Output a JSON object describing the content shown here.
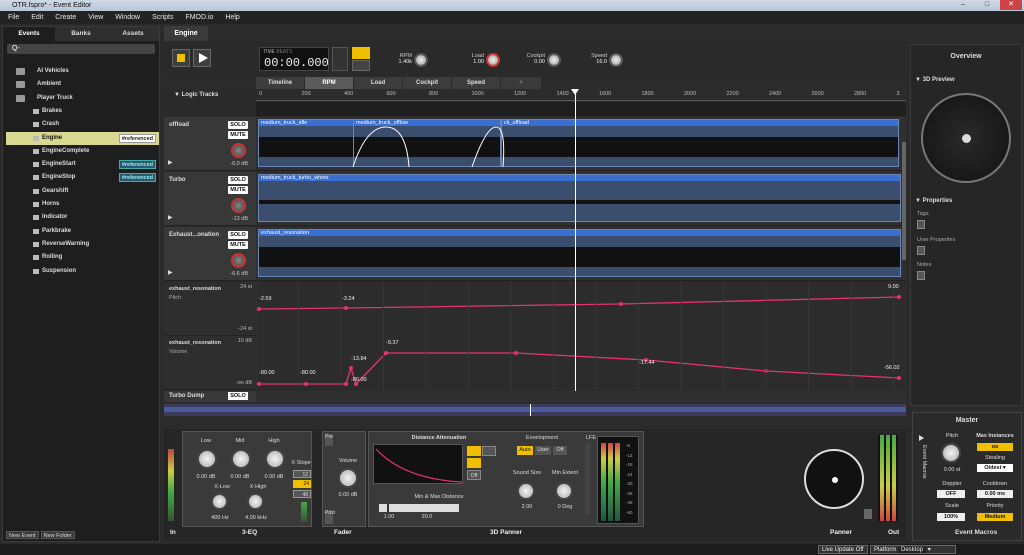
{
  "window": {
    "title": "OTR.fspro* - Event Editor"
  },
  "menu": [
    "File",
    "Edit",
    "Create",
    "View",
    "Window",
    "Scripts",
    "FMOD.io",
    "Help"
  ],
  "browser": {
    "tabs": [
      "Events",
      "Banks",
      "Assets"
    ],
    "search_placeholder": "Q-",
    "folders": [
      "AI Vehicles",
      "Ambient",
      "Player Truck"
    ],
    "events": [
      {
        "name": "Brakes",
        "badge": ""
      },
      {
        "name": "Crash",
        "badge": ""
      },
      {
        "name": "Engine",
        "badge": "#referenced"
      },
      {
        "name": "EngineComplete",
        "badge": ""
      },
      {
        "name": "EngineStart",
        "badge": "#referenced"
      },
      {
        "name": "EngineStop",
        "badge": "#referenced"
      },
      {
        "name": "Gearshift",
        "badge": ""
      },
      {
        "name": "Horns",
        "badge": ""
      },
      {
        "name": "Indicator",
        "badge": ""
      },
      {
        "name": "Parkbrake",
        "badge": ""
      },
      {
        "name": "ReverseWarning",
        "badge": ""
      },
      {
        "name": "Rolling",
        "badge": ""
      },
      {
        "name": "Suspension",
        "badge": ""
      }
    ],
    "footer": [
      "New Event",
      "New Folder"
    ]
  },
  "editor": {
    "tab": "Engine",
    "time_label_1": "TIME",
    "time_label_2": "BEATS",
    "time_value": "00:00.000",
    "params": [
      {
        "name": "RPM",
        "value": "1.40k"
      },
      {
        "name": "Load",
        "value": "1.00"
      },
      {
        "name": "Cockpit",
        "value": "0.00"
      },
      {
        "name": "Speed",
        "value": "16.0"
      }
    ],
    "param_tabs": [
      "Timeline",
      "RPM",
      "Load",
      "Cockpit",
      "Speed",
      "+"
    ],
    "logic_tracks": "Logic Tracks",
    "ruler": [
      "0",
      "200",
      "400",
      "600",
      "800",
      "1000",
      "1200",
      "1400",
      "1600",
      "1800",
      "2000",
      "2200",
      "2400",
      "2600",
      "2800",
      "3"
    ],
    "solo": "SOLO",
    "mute": "MUTE",
    "tracks": [
      {
        "name": "offload",
        "db": "-6.0 dB",
        "clips": [
          "medium_truck_idle",
          "medium_truck_offlow",
          "ck_offload"
        ]
      },
      {
        "name": "Turbo",
        "db": "-13 dB",
        "clips": [
          "medium_truck_turbo_whine"
        ]
      },
      {
        "name": "Exhaust...onation",
        "db": "-6.6 dB",
        "clips": [
          "exhaust_resonation"
        ]
      }
    ],
    "automation": [
      {
        "name": "exhaust_resonation",
        "sub": "Pitch",
        "max": "24 st",
        "min": "-24 st",
        "points": [
          "-2.59",
          "-3.24",
          "9.00"
        ]
      },
      {
        "name": "exhaust_resonation",
        "sub": "Volume",
        "max": "10 dB",
        "min": "-oo dB",
        "points": [
          "-80.00",
          "-80.00",
          "-13.84",
          "-80.00",
          "-9.37",
          "-17.44",
          "-56.02"
        ]
      }
    ],
    "turbo_dump": "Turbo Dump"
  },
  "deck": {
    "eq": {
      "low": "Low",
      "mid": "Mid",
      "high": "High",
      "low_db": "0.00 dB",
      "mid_db": "0.00 dB",
      "high_db": "0.00 dB",
      "xlow": "X-Low",
      "xhigh": "X-High",
      "xlow_v": "400 Hz",
      "xhigh_v": "4.00 kHz",
      "xslope": "X-Slope",
      "slopes": [
        "12",
        "24",
        "48"
      ]
    },
    "fader": {
      "pre": "Pre",
      "post": "Post",
      "vol": "Volume",
      "vol_v": "0.00 dB"
    },
    "panner": {
      "dist": "Distance Attenuation",
      "env": "Envelopment",
      "auto": "Auto",
      "user": "User",
      "off": "Off",
      "ss": "Sound Size",
      "ss_v": "2.00",
      "me": "Min Extent",
      "me_v": "0 Deg",
      "lfe": "LFE",
      "mmd": "Min & Max Distance",
      "slider_min": "1.00",
      "slider_max": "20.0",
      "shape_off": "Off"
    },
    "footers": [
      "In",
      "3-EQ",
      "Fader",
      "3D Panner",
      "Panner",
      "Out",
      "Event Macros"
    ],
    "eq_scale": [
      "-6",
      "-12",
      "-18",
      "-24",
      "-30",
      "-36",
      "-48",
      "-60"
    ]
  },
  "right_panel": {
    "overview": "Overview",
    "preview": "3D Preview",
    "properties": "Properties",
    "tags": "Tags",
    "user_properties": "User Properties",
    "notes": "Notes"
  },
  "master": {
    "title": "Master",
    "pitch": "Pitch",
    "pitch_v": "0.00 st",
    "max_inst": "Max Instances",
    "max_inst_v": "oo",
    "stealing": "Stealing",
    "stealing_v": "Oldest",
    "doppler": "Doppler",
    "doppler_v": "OFF",
    "cooldown": "Cooldown",
    "cooldown_v": "0.00 ms",
    "scale": "Scale",
    "scale_v": "100%",
    "priority": "Priority",
    "priority_v": "Medium",
    "event_macros": "Event Macros"
  },
  "status": {
    "live": "Live Update Off",
    "platform_label": "Platform",
    "platform": "Desktop"
  }
}
